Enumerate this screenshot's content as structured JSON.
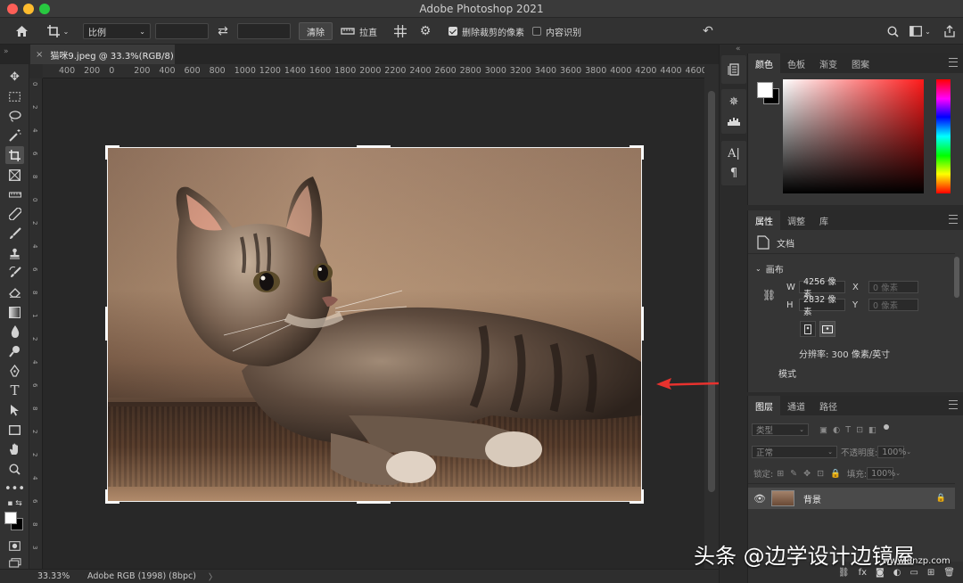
{
  "window": {
    "title": "Adobe Photoshop 2021"
  },
  "options_bar": {
    "ratio_select": "比例",
    "clear_button": "清除",
    "straighten_label": "拉直",
    "delete_cropped_label": "删除裁剪的像素",
    "delete_cropped_checked": true,
    "content_aware_label": "内容识别",
    "content_aware_checked": false
  },
  "document_tab": {
    "title": "猫咪9.jpeg @ 33.3%(RGB/8)"
  },
  "ruler": {
    "horizontal": [
      "400",
      "200",
      "0",
      "200",
      "400",
      "600",
      "800",
      "1000",
      "1200",
      "1400",
      "1600",
      "1800",
      "2000",
      "2200",
      "2400",
      "2600",
      "2800",
      "3000",
      "3200",
      "3400",
      "3600",
      "3800",
      "4000",
      "4200",
      "4400",
      "4600"
    ],
    "vertical": [
      "0",
      "2",
      "4",
      "6",
      "8",
      "0",
      "2",
      "4",
      "6",
      "8",
      "1",
      "2",
      "4",
      "6",
      "8",
      "2",
      "2",
      "4",
      "6",
      "8",
      "3"
    ]
  },
  "status_bar": {
    "zoom": "33.33%",
    "profile": "Adobe RGB (1998) (8bpc)",
    "more": "〉"
  },
  "color_panel": {
    "tabs": [
      "颜色",
      "色板",
      "渐变",
      "图案"
    ],
    "active": "颜色"
  },
  "properties_panel": {
    "tabs": [
      "属性",
      "调整",
      "库"
    ],
    "doc_label": "文档",
    "canvas_section": "画布",
    "w_label": "W",
    "w_value": "4256 像素",
    "x_label": "X",
    "x_placeholder": "0 像素",
    "h_label": "H",
    "h_value": "2832 像素",
    "y_label": "Y",
    "y_placeholder": "0 像素",
    "resolution": "分辨率: 300 像素/英寸",
    "mode_label": "模式"
  },
  "layers_panel": {
    "tabs": [
      "图层",
      "通道",
      "路径"
    ],
    "filter_kind": "类型",
    "blend_mode": "正常",
    "opacity_label": "不透明度:",
    "opacity_value": "100%",
    "lock_label": "锁定:",
    "fill_label": "填充:",
    "fill_value": "100%",
    "layer_name": "背景"
  },
  "watermark": {
    "text": "头条 @边学设计边镜屋",
    "site": "www.dnzp.com"
  },
  "colors": {
    "crop_frame": "#f0f0f0",
    "arrow": "#e8322e",
    "app_bg": "#2b2b2b"
  },
  "icons": [
    "home-icon",
    "crop-icon",
    "swap-icon",
    "straighten-icon",
    "grid-overlay-icon",
    "gear-icon",
    "undo-icon",
    "search-icon",
    "workspace-icon",
    "share-icon"
  ]
}
